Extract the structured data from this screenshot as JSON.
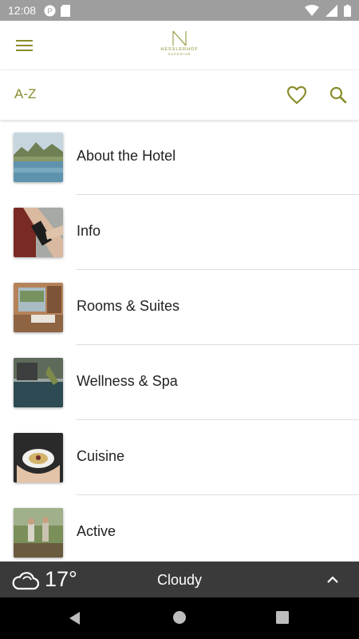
{
  "status_bar": {
    "time": "12:08",
    "left_icons": [
      "app-notification-icon",
      "sd-card-icon"
    ],
    "right_icons": [
      "wifi-icon",
      "cellular-signal-icon",
      "battery-icon"
    ]
  },
  "header": {
    "logo_text": "HESSLERHOF",
    "logo_subtext": "SUPERIOR",
    "menu_icon": "hamburger-menu-icon"
  },
  "toolbar": {
    "az_label": "A-Z",
    "favorites_icon": "heart-icon",
    "search_icon": "search-icon"
  },
  "colors": {
    "accent": "#8a8d2b",
    "weather_bar": "#3a3a3a",
    "status_bar": "#9e9e9e"
  },
  "menu_items": [
    {
      "label": "About the Hotel"
    },
    {
      "label": "Info"
    },
    {
      "label": "Rooms & Suites"
    },
    {
      "label": "Wellness & Spa"
    },
    {
      "label": "Cuisine"
    },
    {
      "label": "Active"
    }
  ],
  "weather": {
    "temperature": "17°",
    "condition": "Cloudy",
    "icon": "cloud-icon",
    "toggle_icon": "chevron-up-icon"
  },
  "navigation": {
    "icons": [
      "back-icon",
      "home-icon",
      "recents-icon"
    ]
  }
}
